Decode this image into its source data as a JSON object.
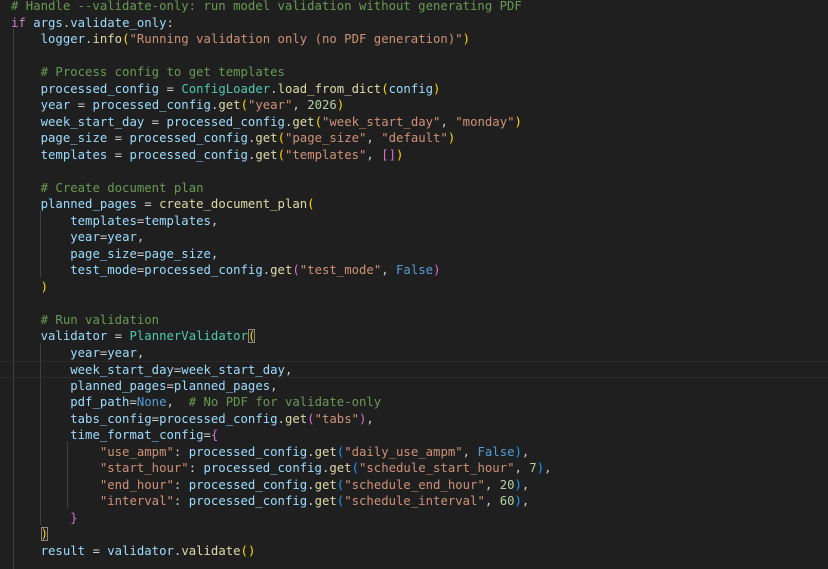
{
  "editor": {
    "language": "python",
    "lines": [
      [
        [
          "comment",
          "# Handle --validate-only: run model validation without generating PDF"
        ]
      ],
      [
        [
          "keyword",
          "if"
        ],
        [
          "plain",
          " "
        ],
        [
          "var",
          "args"
        ],
        [
          "plain",
          "."
        ],
        [
          "var",
          "validate_only"
        ],
        [
          "plain",
          ":"
        ]
      ],
      [
        [
          "plain",
          "    "
        ],
        [
          "var",
          "logger"
        ],
        [
          "plain",
          "."
        ],
        [
          "func",
          "info"
        ],
        [
          "brace2",
          "("
        ],
        [
          "string",
          "\"Running validation only (no PDF generation)\""
        ],
        [
          "brace2",
          ")"
        ]
      ],
      [],
      [
        [
          "plain",
          "    "
        ],
        [
          "comment",
          "# Process config to get templates"
        ]
      ],
      [
        [
          "plain",
          "    "
        ],
        [
          "var",
          "processed_config"
        ],
        [
          "plain",
          " = "
        ],
        [
          "class",
          "ConfigLoader"
        ],
        [
          "plain",
          "."
        ],
        [
          "func",
          "load_from_dict"
        ],
        [
          "brace2",
          "("
        ],
        [
          "var",
          "config"
        ],
        [
          "brace2",
          ")"
        ]
      ],
      [
        [
          "plain",
          "    "
        ],
        [
          "var",
          "year"
        ],
        [
          "plain",
          " = "
        ],
        [
          "var",
          "processed_config"
        ],
        [
          "plain",
          "."
        ],
        [
          "func",
          "get"
        ],
        [
          "brace2",
          "("
        ],
        [
          "string",
          "\"year\""
        ],
        [
          "plain",
          ", "
        ],
        [
          "number",
          "2026"
        ],
        [
          "brace2",
          ")"
        ]
      ],
      [
        [
          "plain",
          "    "
        ],
        [
          "var",
          "week_start_day"
        ],
        [
          "plain",
          " = "
        ],
        [
          "var",
          "processed_config"
        ],
        [
          "plain",
          "."
        ],
        [
          "func",
          "get"
        ],
        [
          "brace2",
          "("
        ],
        [
          "string",
          "\"week_start_day\""
        ],
        [
          "plain",
          ", "
        ],
        [
          "string",
          "\"monday\""
        ],
        [
          "brace2",
          ")"
        ]
      ],
      [
        [
          "plain",
          "    "
        ],
        [
          "var",
          "page_size"
        ],
        [
          "plain",
          " = "
        ],
        [
          "var",
          "processed_config"
        ],
        [
          "plain",
          "."
        ],
        [
          "func",
          "get"
        ],
        [
          "brace2",
          "("
        ],
        [
          "string",
          "\"page_size\""
        ],
        [
          "plain",
          ", "
        ],
        [
          "string",
          "\"default\""
        ],
        [
          "brace2",
          ")"
        ]
      ],
      [
        [
          "plain",
          "    "
        ],
        [
          "var",
          "templates"
        ],
        [
          "plain",
          " = "
        ],
        [
          "var",
          "processed_config"
        ],
        [
          "plain",
          "."
        ],
        [
          "func",
          "get"
        ],
        [
          "brace2",
          "("
        ],
        [
          "string",
          "\"templates\""
        ],
        [
          "plain",
          ", "
        ],
        [
          "brace1",
          "[]"
        ],
        [
          "brace2",
          ")"
        ]
      ],
      [],
      [
        [
          "plain",
          "    "
        ],
        [
          "comment",
          "# Create document plan"
        ]
      ],
      [
        [
          "plain",
          "    "
        ],
        [
          "var",
          "planned_pages"
        ],
        [
          "plain",
          " = "
        ],
        [
          "func",
          "create_document_plan"
        ],
        [
          "brace2",
          "("
        ]
      ],
      [
        [
          "plain",
          "        "
        ],
        [
          "param",
          "templates"
        ],
        [
          "plain",
          "="
        ],
        [
          "var",
          "templates"
        ],
        [
          "plain",
          ","
        ]
      ],
      [
        [
          "plain",
          "        "
        ],
        [
          "param",
          "year"
        ],
        [
          "plain",
          "="
        ],
        [
          "var",
          "year"
        ],
        [
          "plain",
          ","
        ]
      ],
      [
        [
          "plain",
          "        "
        ],
        [
          "param",
          "page_size"
        ],
        [
          "plain",
          "="
        ],
        [
          "var",
          "page_size"
        ],
        [
          "plain",
          ","
        ]
      ],
      [
        [
          "plain",
          "        "
        ],
        [
          "param",
          "test_mode"
        ],
        [
          "plain",
          "="
        ],
        [
          "var",
          "processed_config"
        ],
        [
          "plain",
          "."
        ],
        [
          "func",
          "get"
        ],
        [
          "brace1",
          "("
        ],
        [
          "string",
          "\"test_mode\""
        ],
        [
          "plain",
          ", "
        ],
        [
          "const",
          "False"
        ],
        [
          "brace1",
          ")"
        ]
      ],
      [
        [
          "plain",
          "    "
        ],
        [
          "brace2",
          ")"
        ]
      ],
      [],
      [
        [
          "plain",
          "    "
        ],
        [
          "comment",
          "# Run validation"
        ]
      ],
      [
        [
          "plain",
          "    "
        ],
        [
          "var",
          "validator"
        ],
        [
          "plain",
          " = "
        ],
        [
          "class",
          "PlannerValidator"
        ],
        [
          "brace2-match",
          "("
        ]
      ],
      [
        [
          "plain",
          "        "
        ],
        [
          "param",
          "year"
        ],
        [
          "plain",
          "="
        ],
        [
          "var",
          "year"
        ],
        [
          "plain",
          ","
        ]
      ],
      [
        [
          "plain",
          "        "
        ],
        [
          "param",
          "week_start_day"
        ],
        [
          "plain",
          "="
        ],
        [
          "var",
          "week_start_day"
        ],
        [
          "plain",
          ","
        ]
      ],
      [
        [
          "plain",
          "        "
        ],
        [
          "param",
          "planned_pages"
        ],
        [
          "plain",
          "="
        ],
        [
          "var",
          "planned_pages"
        ],
        [
          "plain",
          ","
        ]
      ],
      [
        [
          "plain",
          "        "
        ],
        [
          "param",
          "pdf_path"
        ],
        [
          "plain",
          "="
        ],
        [
          "const",
          "None"
        ],
        [
          "plain",
          ",  "
        ],
        [
          "comment",
          "# No PDF for validate-only"
        ]
      ],
      [
        [
          "plain",
          "        "
        ],
        [
          "param",
          "tabs_config"
        ],
        [
          "plain",
          "="
        ],
        [
          "var",
          "processed_config"
        ],
        [
          "plain",
          "."
        ],
        [
          "func",
          "get"
        ],
        [
          "brace1",
          "("
        ],
        [
          "string",
          "\"tabs\""
        ],
        [
          "brace1",
          ")"
        ],
        [
          "plain",
          ","
        ]
      ],
      [
        [
          "plain",
          "        "
        ],
        [
          "param",
          "time_format_config"
        ],
        [
          "plain",
          "="
        ],
        [
          "brace1",
          "{"
        ]
      ],
      [
        [
          "plain",
          "            "
        ],
        [
          "string",
          "\"use_ampm\""
        ],
        [
          "plain",
          ": "
        ],
        [
          "var",
          "processed_config"
        ],
        [
          "plain",
          "."
        ],
        [
          "func",
          "get"
        ],
        [
          "brace3",
          "("
        ],
        [
          "string",
          "\"daily_use_ampm\""
        ],
        [
          "plain",
          ", "
        ],
        [
          "const",
          "False"
        ],
        [
          "brace3",
          ")"
        ],
        [
          "plain",
          ","
        ]
      ],
      [
        [
          "plain",
          "            "
        ],
        [
          "string",
          "\"start_hour\""
        ],
        [
          "plain",
          ": "
        ],
        [
          "var",
          "processed_config"
        ],
        [
          "plain",
          "."
        ],
        [
          "func",
          "get"
        ],
        [
          "brace3",
          "("
        ],
        [
          "string",
          "\"schedule_start_hour\""
        ],
        [
          "plain",
          ", "
        ],
        [
          "number",
          "7"
        ],
        [
          "brace3",
          ")"
        ],
        [
          "plain",
          ","
        ]
      ],
      [
        [
          "plain",
          "            "
        ],
        [
          "string",
          "\"end_hour\""
        ],
        [
          "plain",
          ": "
        ],
        [
          "var",
          "processed_config"
        ],
        [
          "plain",
          "."
        ],
        [
          "func",
          "get"
        ],
        [
          "brace3",
          "("
        ],
        [
          "string",
          "\"schedule_end_hour\""
        ],
        [
          "plain",
          ", "
        ],
        [
          "number",
          "20"
        ],
        [
          "brace3",
          ")"
        ],
        [
          "plain",
          ","
        ]
      ],
      [
        [
          "plain",
          "            "
        ],
        [
          "string",
          "\"interval\""
        ],
        [
          "plain",
          ": "
        ],
        [
          "var",
          "processed_config"
        ],
        [
          "plain",
          "."
        ],
        [
          "func",
          "get"
        ],
        [
          "brace3",
          "("
        ],
        [
          "string",
          "\"schedule_interval\""
        ],
        [
          "plain",
          ", "
        ],
        [
          "number",
          "60"
        ],
        [
          "brace3",
          ")"
        ],
        [
          "plain",
          ","
        ]
      ],
      [
        [
          "plain",
          "        "
        ],
        [
          "brace1",
          "}"
        ]
      ],
      [
        [
          "plain",
          "    "
        ],
        [
          "brace2-match",
          ")"
        ]
      ],
      [
        [
          "plain",
          "    "
        ],
        [
          "var",
          "result"
        ],
        [
          "plain",
          " = "
        ],
        [
          "var",
          "validator"
        ],
        [
          "plain",
          "."
        ],
        [
          "func",
          "validate"
        ],
        [
          "brace2",
          "()"
        ]
      ]
    ],
    "current_line_index": 22,
    "colors": {
      "background": "#1f1f1f",
      "comment": "#6a9955",
      "keyword": "#c586c0",
      "string": "#ce9178",
      "function": "#dcdcaa",
      "class": "#4ec9b0",
      "variable": "#9cdcfe",
      "constant": "#569cd6",
      "number": "#b5cea8"
    }
  }
}
